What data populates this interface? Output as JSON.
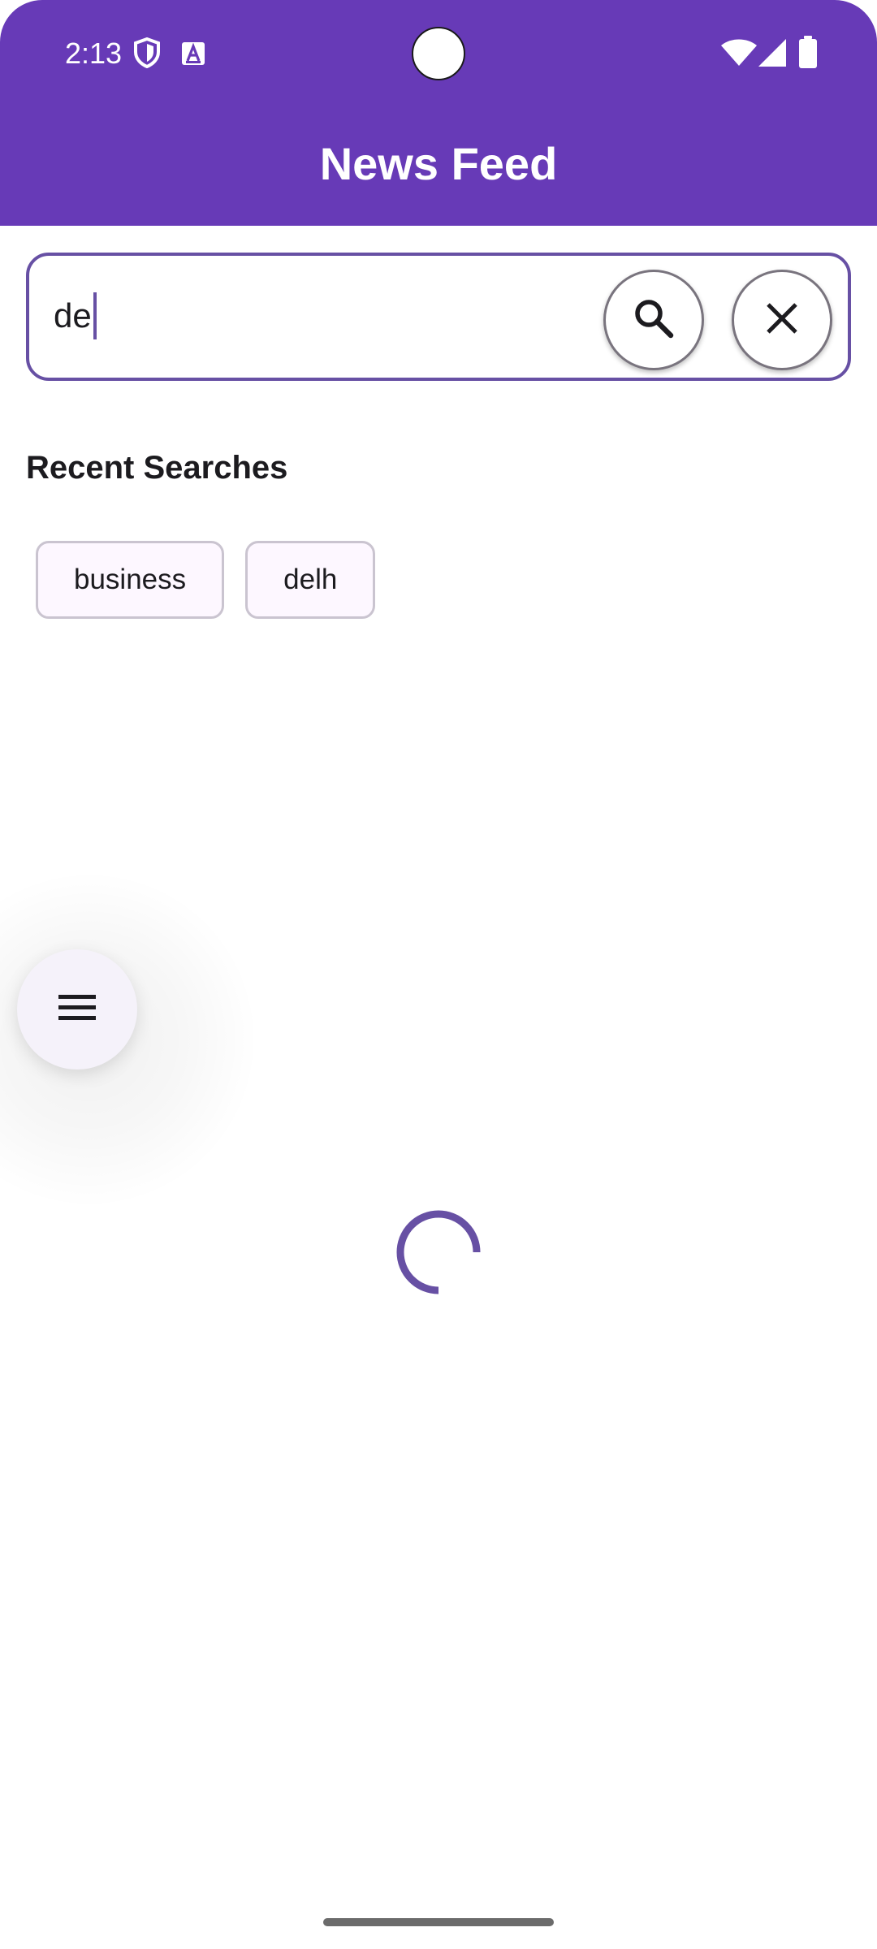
{
  "status_bar": {
    "time": "2:13",
    "icons": [
      "shield-icon",
      "font-a-icon",
      "wifi-icon",
      "cellular-signal-icon",
      "battery-icon"
    ]
  },
  "header": {
    "title": "News Feed",
    "background_color": "#673ab7"
  },
  "search": {
    "value": "de",
    "search_button_icon": "search-icon",
    "clear_button_icon": "close-icon",
    "accent_color": "#6750a4"
  },
  "recent": {
    "title": "Recent Searches",
    "items": [
      "business",
      "delh"
    ]
  },
  "fab": {
    "icon": "menu-icon"
  },
  "loading": {
    "indicator": "spinner",
    "color": "#6750a4"
  }
}
